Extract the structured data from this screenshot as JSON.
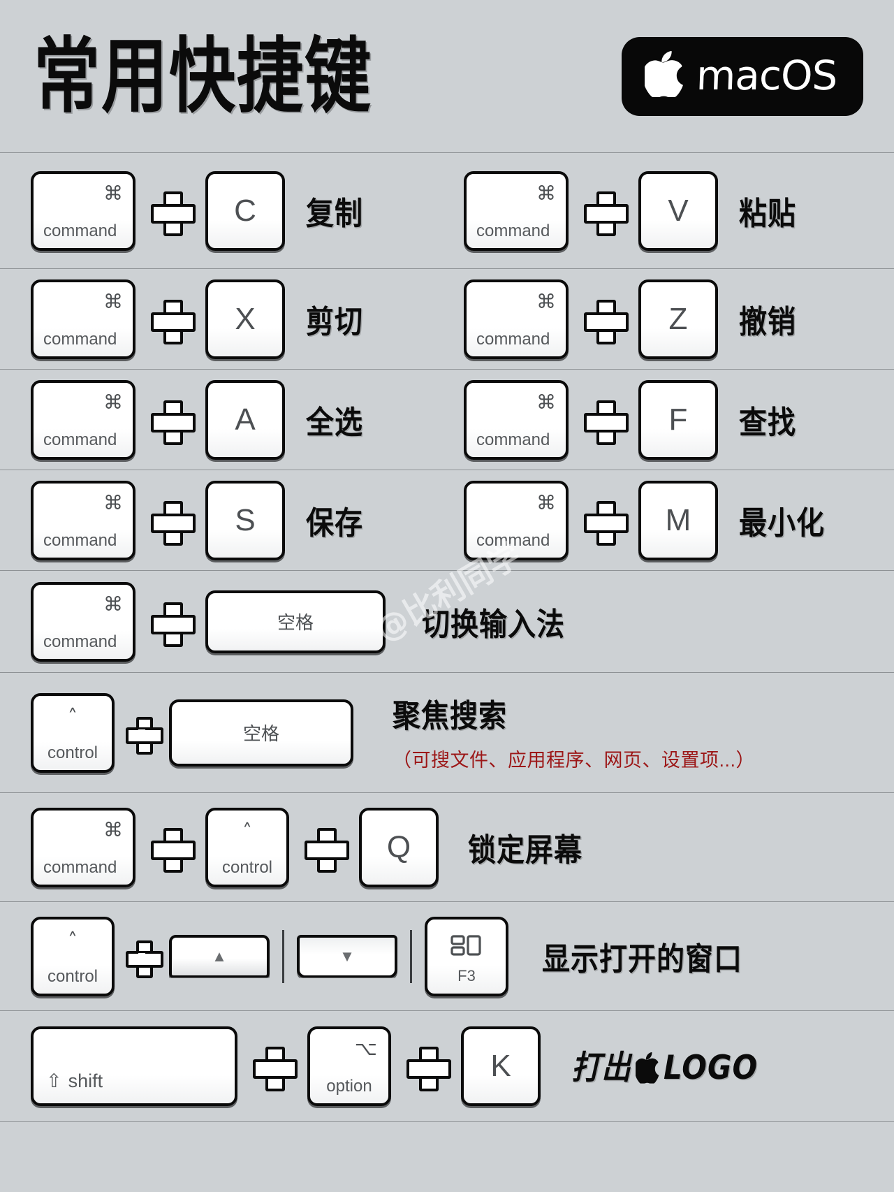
{
  "header": {
    "title": "常用快捷键",
    "badge": {
      "apple_icon": "apple-logo-icon",
      "os_name": "macOS"
    }
  },
  "watermark": "@比利同学",
  "colors": {
    "background": "#cdd1d4",
    "key_face": "#ffffff",
    "key_border": "#0a0a0a",
    "label_text": "#0b0b0b",
    "accent_red": "#9c1717",
    "badge_bg": "#080808",
    "divider": "#8e9295"
  },
  "keycaps": {
    "command": {
      "glyph": "⌘",
      "sub": "command"
    },
    "control": {
      "glyph": "˄",
      "sub": "control"
    },
    "option": {
      "glyph": "⌥",
      "sub": "option"
    },
    "shift": {
      "glyph": "⇧",
      "sub": "shift"
    },
    "space": {
      "sub": "空格"
    },
    "f3": {
      "icon": "mission-control-icon",
      "sub": "F3"
    },
    "arrow_up": {
      "glyph": "▲"
    },
    "arrow_down": {
      "glyph": "▼"
    }
  },
  "plus_symbol": "+",
  "rows": [
    {
      "left": {
        "keys": [
          "command",
          "C"
        ],
        "label": "复制"
      },
      "right": {
        "keys": [
          "command",
          "V"
        ],
        "label": "粘贴"
      }
    },
    {
      "left": {
        "keys": [
          "command",
          "X"
        ],
        "label": "剪切"
      },
      "right": {
        "keys": [
          "command",
          "Z"
        ],
        "label": "撤销"
      }
    },
    {
      "left": {
        "keys": [
          "command",
          "A"
        ],
        "label": "全选"
      },
      "right": {
        "keys": [
          "command",
          "F"
        ],
        "label": "查找"
      }
    },
    {
      "left": {
        "keys": [
          "command",
          "S"
        ],
        "label": "保存"
      },
      "right": {
        "keys": [
          "command",
          "M"
        ],
        "label": "最小化"
      }
    },
    {
      "full": {
        "keys": [
          "command",
          "空格"
        ],
        "label": "切换输入法"
      }
    },
    {
      "full": {
        "keys": [
          "control",
          "空格"
        ],
        "label": "聚焦搜索",
        "sublabel": "（可搜文件、应用程序、网页、设置项...）"
      }
    },
    {
      "full": {
        "keys": [
          "command",
          "control",
          "Q"
        ],
        "label": "锁定屏幕"
      }
    },
    {
      "full": {
        "keys": [
          "control",
          "▲",
          "▼",
          "F3"
        ],
        "label": "显示打开的窗口"
      }
    },
    {
      "full": {
        "keys": [
          "shift",
          "option",
          "K"
        ],
        "label_pre": "打出",
        "label_icon": "apple-logo-icon",
        "label_post": "LOGO"
      }
    }
  ],
  "letters": {
    "c": "C",
    "v": "V",
    "x": "X",
    "z": "Z",
    "a": "A",
    "f": "F",
    "s": "S",
    "m": "M",
    "q": "Q",
    "k": "K"
  }
}
